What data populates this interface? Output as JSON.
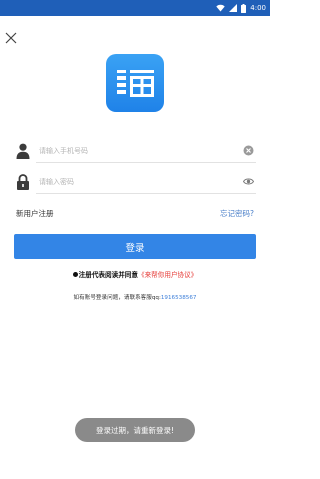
{
  "status_bar": {
    "time": "4:00",
    "bg_color": "#1f5fb8",
    "icons": [
      "wifi-icon",
      "cell-signal-icon",
      "battery-icon"
    ]
  },
  "header": {
    "close_icon": "close-icon"
  },
  "logo": {
    "icon": "app-logo-icon",
    "colors": [
      "#3aa2f4",
      "#1f82e8"
    ]
  },
  "form": {
    "phone": {
      "placeholder": "请输入手机号码",
      "value": "",
      "lead_icon": "user-icon",
      "trail_icon": "clear-icon"
    },
    "password": {
      "placeholder": "请输入密码",
      "value": "",
      "lead_icon": "lock-icon",
      "trail_icon": "eye-icon"
    },
    "register_label": "新用户注册",
    "forgot_label": "忘记密码?",
    "login_label": "登录",
    "primary_color": "#3385e6"
  },
  "agreement": {
    "prefix": "注册代表阅读并同意",
    "link": "《来帮你用户协议》",
    "link_color": "#e53935"
  },
  "support": {
    "prefix": "如有账号登录问题，请联系客服qq:",
    "qq": "1916538567"
  },
  "toast": {
    "message": "登录过期，请重新登录!"
  }
}
